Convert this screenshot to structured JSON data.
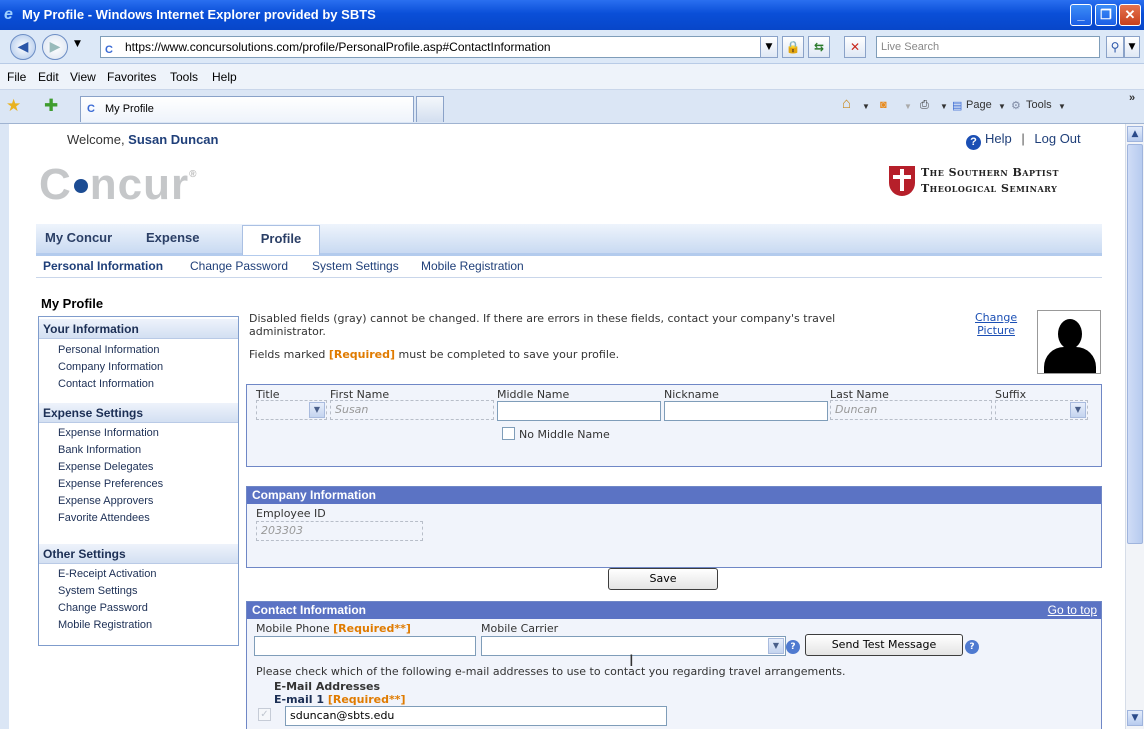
{
  "window": {
    "title": "My Profile - Windows Internet Explorer provided by SBTS",
    "url": "https://www.concursolutions.com/profile/PersonalProfile.asp#ContactInformation",
    "search_placeholder": "Live Search",
    "menu": [
      "File",
      "Edit",
      "View",
      "Favorites",
      "Tools",
      "Help"
    ],
    "tab_title": "My Profile",
    "cmd_page": "Page",
    "cmd_tools": "Tools"
  },
  "header": {
    "welcome_prefix": "Welcome, ",
    "user_name": "Susan Duncan",
    "help": "Help",
    "separator": "|",
    "logout": "Log Out",
    "logo_text_a": "C",
    "logo_text_b": "ncur",
    "logo_reg": "®",
    "org_line1": "The Southern Baptist",
    "org_line2": "Theological Seminary"
  },
  "nav": {
    "tabs": [
      "My Concur",
      "Expense",
      "Profile"
    ],
    "subtabs": [
      "Personal Information",
      "Change Password",
      "System Settings",
      "Mobile Registration"
    ]
  },
  "sidebar": {
    "title": "My Profile",
    "sections": [
      {
        "name": "Your Information",
        "items": [
          "Personal Information",
          "Company Information",
          "Contact Information"
        ]
      },
      {
        "name": "Expense Settings",
        "items": [
          "Expense Information",
          "Bank Information",
          "Expense Delegates",
          "Expense Preferences",
          "Expense Approvers",
          "Favorite Attendees"
        ]
      },
      {
        "name": "Other Settings",
        "items": [
          "E-Receipt Activation",
          "System Settings",
          "Change Password",
          "Mobile Registration"
        ]
      }
    ]
  },
  "main": {
    "note1a": "Disabled fields (gray) cannot be changed. If there are errors in these fields, contact your company's travel",
    "note1b": "administrator.",
    "note2_prefix": "Fields marked ",
    "note2_required": "[Required]",
    "note2_suffix": " must be completed to save your profile.",
    "change_picture_1": "Change",
    "change_picture_2": "Picture",
    "name_labels": {
      "title": "Title",
      "first": "First Name",
      "middle": "Middle Name",
      "nickname": "Nickname",
      "last": "Last Name",
      "suffix": "Suffix"
    },
    "name_values": {
      "first": "Susan",
      "middle": "",
      "nickname": "",
      "last": "Duncan"
    },
    "no_middle_name": "No Middle Name",
    "company": {
      "header": "Company Information",
      "employee_id_label": "Employee ID",
      "employee_id": "203303"
    },
    "save_label": "Save",
    "contact": {
      "header": "Contact Information",
      "go_to_top": "Go to top",
      "mobile_phone_label": "Mobile Phone ",
      "mobile_phone_required": "[Required**]",
      "mobile_phone": "",
      "carrier_label": "Mobile Carrier",
      "carrier": "",
      "send_test": "Send Test Message",
      "email_note": "Please check which of the following e-mail addresses to use to contact you regarding travel arrangements.",
      "email_heading": "E-Mail Addresses",
      "email1_label": "E-mail 1 ",
      "email1_required": "[Required**]",
      "email1": "sduncan@sbts.edu"
    }
  }
}
